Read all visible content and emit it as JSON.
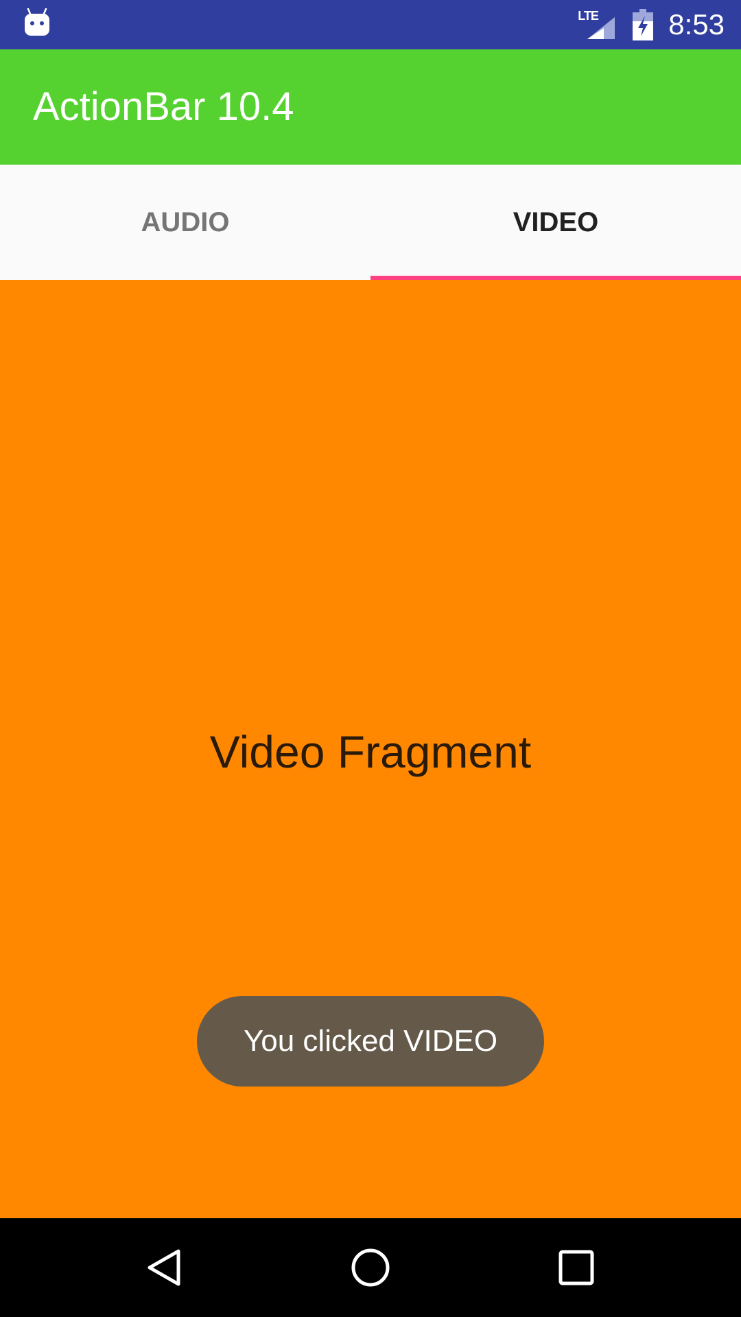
{
  "status_bar": {
    "network_label": "LTE",
    "time": "8:53",
    "icons": [
      "android-debug-icon",
      "lte-signal-icon",
      "battery-charging-icon"
    ],
    "background": "#303F9F"
  },
  "app_bar": {
    "title": "ActionBar 10.4",
    "background": "#55D22F"
  },
  "tabs": [
    {
      "label": "AUDIO",
      "selected": false
    },
    {
      "label": "VIDEO",
      "selected": true
    }
  ],
  "tab_indicator_color": "#FF4081",
  "content": {
    "fragment_label": "Video Fragment",
    "background": "#FF8800"
  },
  "toast": {
    "message": "You clicked VIDEO"
  },
  "nav_bar": {
    "buttons": [
      "back-icon",
      "home-icon",
      "recents-icon"
    ]
  }
}
